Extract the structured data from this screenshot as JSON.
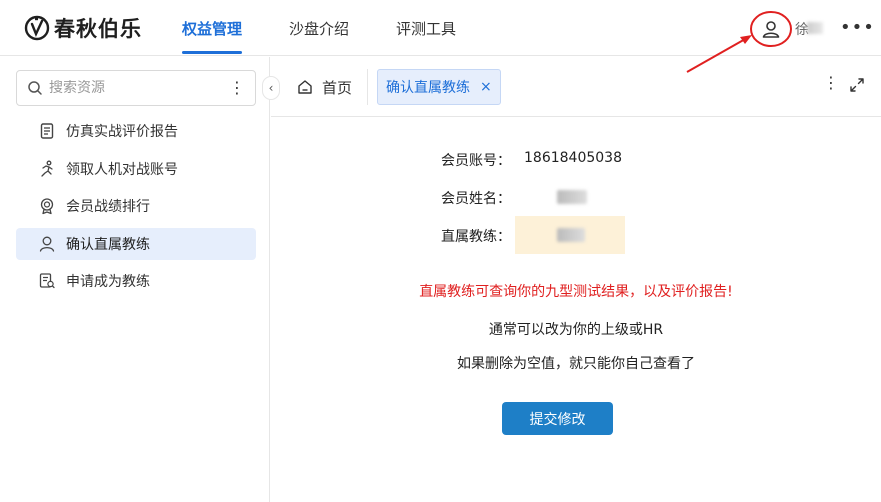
{
  "brand": {
    "name": "春秋伯乐"
  },
  "nav": {
    "items": [
      {
        "label": "权益管理",
        "active": true
      },
      {
        "label": "沙盘介绍",
        "active": false
      },
      {
        "label": "评测工具",
        "active": false
      }
    ]
  },
  "user": {
    "name_visible": "徐",
    "icon": "user-icon"
  },
  "header": {
    "more_icon": "more-horizontal-icon"
  },
  "sidebar": {
    "search": {
      "placeholder": "搜索资源",
      "value": ""
    },
    "items": [
      {
        "label": "仿真实战评价报告",
        "icon": "document-icon",
        "active": false
      },
      {
        "label": "领取人机对战账号",
        "icon": "running-person-icon",
        "active": false
      },
      {
        "label": "会员战绩排行",
        "icon": "medal-icon",
        "active": false
      },
      {
        "label": "确认直属教练",
        "icon": "coach-person-icon",
        "active": true
      },
      {
        "label": "申请成为教练",
        "icon": "application-form-icon",
        "active": false
      }
    ]
  },
  "tabs": {
    "home": "首页",
    "active": "确认直属教练",
    "close": "×"
  },
  "form": {
    "account_label": "会员账号：",
    "account_value": "18618405038",
    "name_label": "会员姓名：",
    "coach_label": "直属教练："
  },
  "messages": {
    "warning": "直属教练可查询你的九型测试结果，以及评价报告!",
    "line1": "通常可以改为你的上级或HR",
    "line2": "如果删除为空值，就只能你自己查看了"
  },
  "actions": {
    "submit": "提交修改"
  },
  "colors": {
    "accent": "#1e6fd8",
    "button": "#1e7fc7",
    "warning": "#e02020",
    "highlight": "#fdf1d8",
    "annotation": "#e02020"
  }
}
